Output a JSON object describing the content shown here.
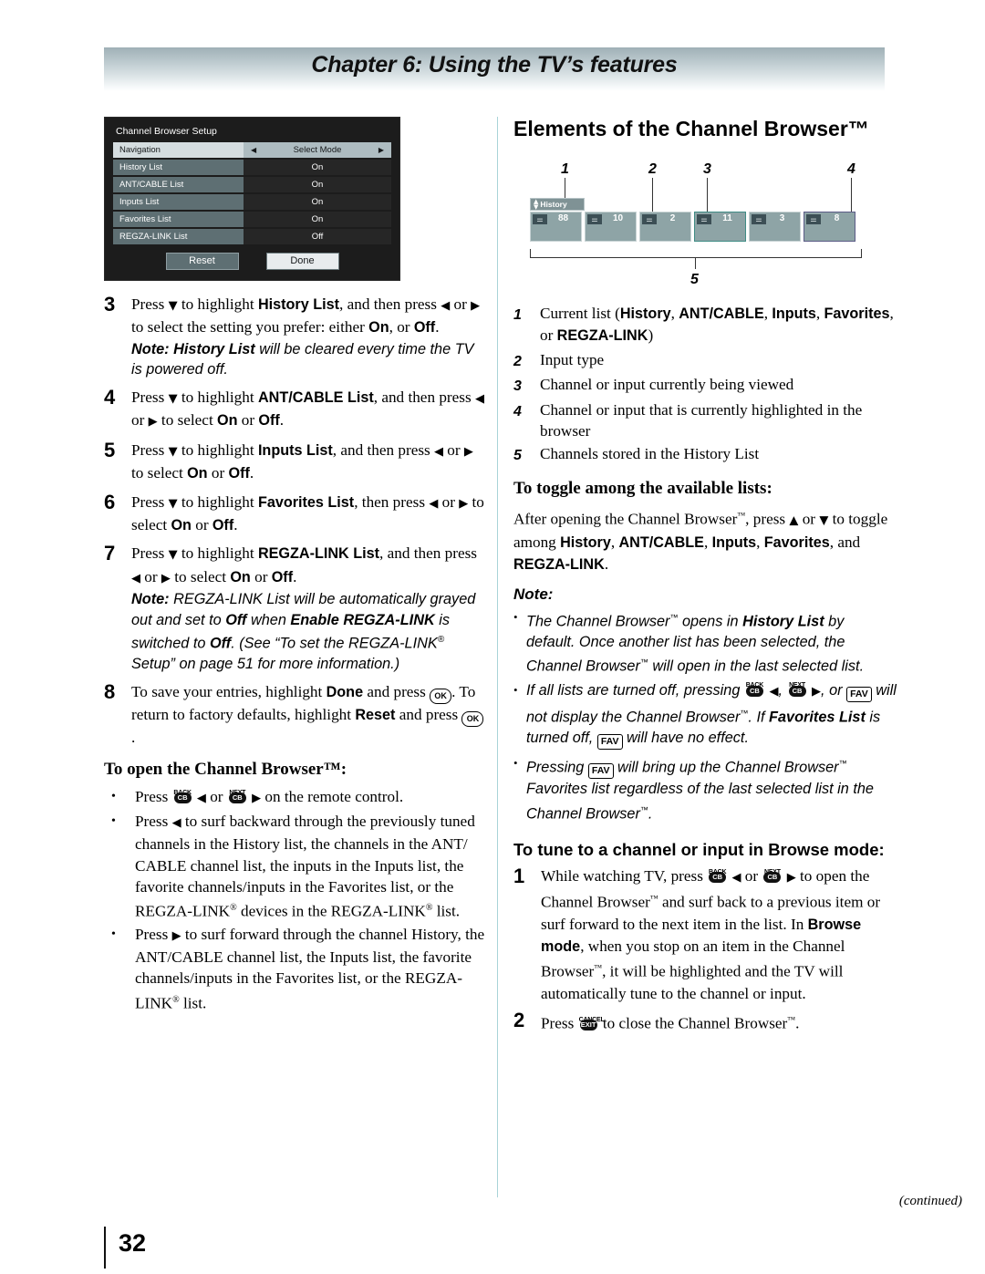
{
  "header": {
    "chapter_title": "Chapter 6: Using the TV’s features"
  },
  "footer": {
    "continued": "(continued)",
    "page_number": "32"
  },
  "tv_dialog": {
    "title": "Channel Browser Setup",
    "rows": [
      {
        "label": "Navigation",
        "value": "Select Mode",
        "selected": true,
        "arrow_left": "◀",
        "arrow_right": "▶"
      },
      {
        "label": "History List",
        "value": "On",
        "selected": false
      },
      {
        "label": "ANT/CABLE List",
        "value": "On",
        "selected": false
      },
      {
        "label": "Inputs List",
        "value": "On",
        "selected": false
      },
      {
        "label": "Favorites List",
        "value": "On",
        "selected": false
      },
      {
        "label": "REGZA-LINK List",
        "value": "Off",
        "selected": false
      }
    ],
    "buttons": {
      "reset": "Reset",
      "done": "Done"
    }
  },
  "left_column": {
    "steps": [
      {
        "num": "3",
        "text_html": "Press <span class=\"tri\">▼</span> to highlight <span class=\"blk\">History List</span>, and then press <span class=\"tri\">◀</span> or <span class=\"tri\">▶</span> to select the setting you prefer: either <span class=\"blk\">On</span>, or <span class=\"blk\">Off</span>.",
        "note_html": "<b>Note: History List</b> will be cleared every time the TV is powered off."
      },
      {
        "num": "4",
        "text_html": "Press <span class=\"tri\">▼</span> to highlight <span class=\"blk\">ANT/CABLE List</span>, and then press <span class=\"tri\">◀</span> or <span class=\"tri\">▶</span> to select <span class=\"blk\">On</span> or <span class=\"blk\">Off</span>.",
        "note_html": ""
      },
      {
        "num": "5",
        "text_html": "Press <span class=\"tri\">▼</span> to highlight <span class=\"blk\">Inputs List</span>, and then press <span class=\"tri\">◀</span> or <span class=\"tri\">▶</span> to select <span class=\"blk\">On</span> or <span class=\"blk\">Off</span>.",
        "note_html": ""
      },
      {
        "num": "6",
        "text_html": "Press <span class=\"tri\">▼</span> to highlight <span class=\"blk\">Favorites List</span>, then press <span class=\"tri\">◀</span> or <span class=\"tri\">▶</span> to select <span class=\"blk\">On</span> or <span class=\"blk\">Off</span>.",
        "note_html": ""
      },
      {
        "num": "7",
        "text_html": "Press <span class=\"tri\">▼</span> to highlight <span class=\"blk\">REGZA-LINK List</span>, and then press <span class=\"tri\">◀</span> or <span class=\"tri\">▶</span> to select <span class=\"blk\">On</span> or <span class=\"blk\">Off</span>.",
        "note_html": "<b>Note:</b> REGZA-LINK List will be automatically grayed out and set to <b>Off</b> when <b>Enable REGZA-LINK</b> is switched to <b>Off</b>. (See “To set the REGZA-LINK<span class=\"reg\">®</span> Setup” on page 51 for more information.)"
      },
      {
        "num": "8",
        "text_html": "To save your entries, highlight <span class=\"blk\">Done</span> and press <span class=\"key-ok\">OK</span>. To return to factory defaults, highlight <span class=\"blk\">Reset</span> and press <span class=\"key-ok\">OK</span>.",
        "note_html": ""
      }
    ],
    "open_heading": "To open the Channel Browser™:",
    "open_bullets": [
      "Press <span class=\"key-cb\"><span class=\"cap\">BACK</span><span class=\"pill\">CB</span></span> <span class=\"tri\">◀</span> or <span class=\"key-cb\"><span class=\"cap\">NEXT</span><span class=\"pill\">CB</span></span> <span class=\"tri\">▶</span> on the remote control.",
      "Press <span class=\"tri\">◀</span> to surf backward through the previously tuned channels in the History list, the channels in the ANT/ CABLE channel list, the inputs in the Inputs list, the favorite channels/inputs in the Favorites list, or the REGZA-LINK<span class=\"reg\">®</span> devices in the REGZA-LINK<span class=\"reg\">®</span> list.",
      "Press <span class=\"tri\">▶</span> to surf forward through the channel History, the ANT/CABLE channel list, the Inputs list, the favorite channels/inputs in the Favorites list, or the REGZA-LINK<span class=\"reg\">®</span> list."
    ]
  },
  "right_column": {
    "title": "Elements of the Channel Browser™",
    "diagram": {
      "callouts": [
        "1",
        "2",
        "3",
        "4",
        "5"
      ],
      "list_tag_label": "History",
      "tiles": [
        {
          "channel": "88",
          "state": "normal"
        },
        {
          "channel": "10",
          "state": "normal"
        },
        {
          "channel": "2",
          "state": "normal"
        },
        {
          "channel": "11",
          "state": "viewing"
        },
        {
          "channel": "3",
          "state": "normal"
        },
        {
          "channel": "8",
          "state": "highlighted"
        }
      ],
      "icon": "antenna-icon",
      "colors": {
        "tile_fill": "#8ea4a6",
        "tile_border": "#c8d3d4",
        "viewing_border": "#3f8c85",
        "highlight_border": "#5b5b86",
        "tag_fill": "#7f9295"
      }
    },
    "elements": [
      {
        "num": "1",
        "html": "Current list (<span class=\"blk\">History</span>, <span class=\"blk\">ANT/CABLE</span>, <span class=\"blk\">Inputs</span>, <span class=\"blk\">Favorites</span>, or <span class=\"blk\">REGZA-LINK</span>)"
      },
      {
        "num": "2",
        "html": "Input type"
      },
      {
        "num": "3",
        "html": "Channel or input currently being viewed"
      },
      {
        "num": "4",
        "html": "Channel or input that is currently highlighted in the browser"
      },
      {
        "num": "5",
        "html": "Channels stored in the History List"
      }
    ],
    "toggle_heading": "To toggle among the available lists:",
    "toggle_para_html": "After opening the Channel Browser<span class=\"sup\">™</span>, press <span class=\"tri\">▲</span> or <span class=\"tri\">▼</span> to toggle among <span class=\"blk\">History</span>, <span class=\"blk\">ANT/CABLE</span>, <span class=\"blk\">Inputs</span>, <span class=\"blk\">Favorites</span>, and <span class=\"blk\">REGZA-LINK</span>.",
    "note_label": "Note:",
    "notes": [
      "The Channel Browser<span class=\"sup\">™</span> opens in <b>History List</b> by default. Once another list has been selected, the Channel Browser<span class=\"sup\">™</span> will open in the last selected list.",
      "If all lists are turned off, pressing <span class=\"key-cb\"><span class=\"cap\">BACK</span><span class=\"pill\">CB</span></span> <span class=\"tri\">◀</span>, <span class=\"key-cb\"><span class=\"cap\">NEXT</span><span class=\"pill\">CB</span></span> <span class=\"tri\">▶</span>, or <span class=\"key-fav\">FAV</span> will not display the Channel Browser<span class=\"sup\">™</span>. If <b>Favorites List</b> is turned off, <span class=\"key-fav\">FAV</span> will have no effect.",
      "Pressing <span class=\"key-fav\">FAV</span> will bring up the Channel Browser<span class=\"sup\">™</span> Favorites list regardless of the last selected list in the Channel Browser<span class=\"sup\">™</span>."
    ],
    "tune_heading": "To tune to a channel or input in Browse mode:",
    "tune_steps": [
      {
        "num": "1",
        "html": "While watching TV, press <span class=\"key-cb\"><span class=\"cap\">BACK</span><span class=\"pill\">CB</span></span> <span class=\"tri\">◀</span> or <span class=\"key-cb\"><span class=\"cap\">NEXT</span><span class=\"pill\">CB</span></span> <span class=\"tri\">▶</span> to open the Channel Browser<span class=\"sup\">™</span> and surf back to a previous item or surf forward to the next item in the list. In <span class=\"blk\">Browse mode</span>, when you stop on an item in the Channel Browser<span class=\"sup\">™</span>, it will be highlighted and the TV will automatically tune to the channel or input."
      },
      {
        "num": "2",
        "html": "Press <span class=\"key-cb\"><span class=\"cap\">CANCEL</span><span class=\"pill\">EXIT</span></span> to close the Channel Browser<span class=\"sup\">™</span>."
      }
    ]
  }
}
